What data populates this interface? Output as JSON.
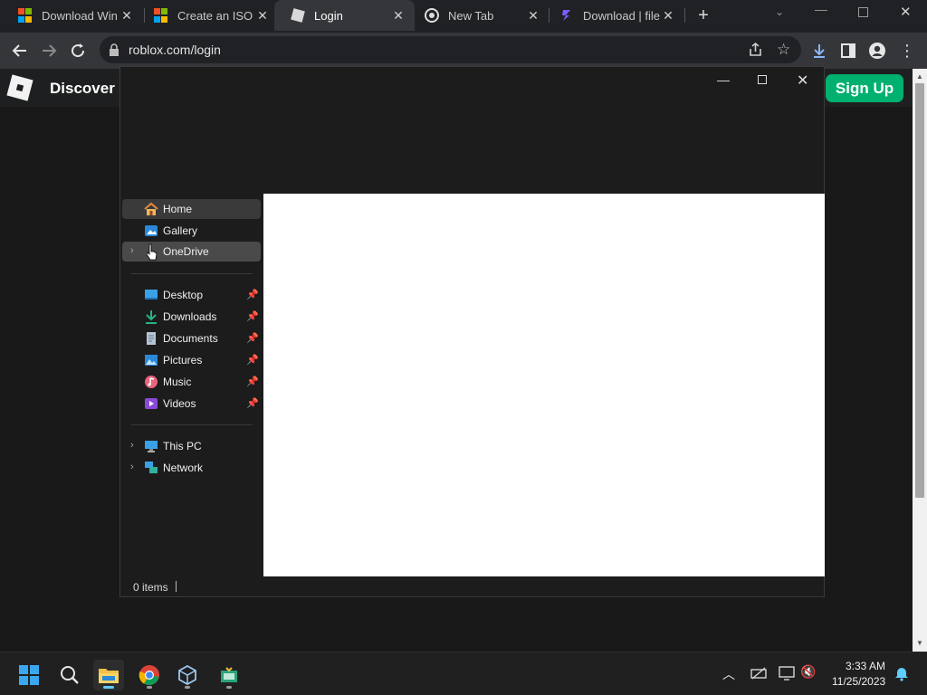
{
  "browser": {
    "tabs": [
      {
        "title": "Download Win",
        "icon": "microsoft-icon"
      },
      {
        "title": "Create an ISO f",
        "icon": "microsoft-icon"
      },
      {
        "title": "Login",
        "icon": "roblox-icon"
      },
      {
        "title": "New Tab",
        "icon": "chrome-icon"
      },
      {
        "title": "Download | file",
        "icon": "filecr-icon"
      }
    ],
    "url": "roblox.com/login"
  },
  "site": {
    "nav_text": "Discover",
    "signup_label": "Sign Up",
    "signup_color": "#00b06f"
  },
  "explorer": {
    "nav": [
      {
        "label": "Home",
        "icon": "home-icon"
      },
      {
        "label": "Gallery",
        "icon": "gallery-icon"
      },
      {
        "label": "OneDrive",
        "icon": "onedrive-icon"
      },
      {
        "label": "Desktop",
        "icon": "desktop-icon"
      },
      {
        "label": "Downloads",
        "icon": "downloads-icon"
      },
      {
        "label": "Documents",
        "icon": "documents-icon"
      },
      {
        "label": "Pictures",
        "icon": "pictures-icon"
      },
      {
        "label": "Music",
        "icon": "music-icon"
      },
      {
        "label": "Videos",
        "icon": "videos-icon"
      },
      {
        "label": "This PC",
        "icon": "this-pc-icon"
      },
      {
        "label": "Network",
        "icon": "network-icon"
      }
    ],
    "status": "0 items"
  },
  "taskbar": {
    "time": "3:33 AM",
    "date": "11/25/2023"
  }
}
